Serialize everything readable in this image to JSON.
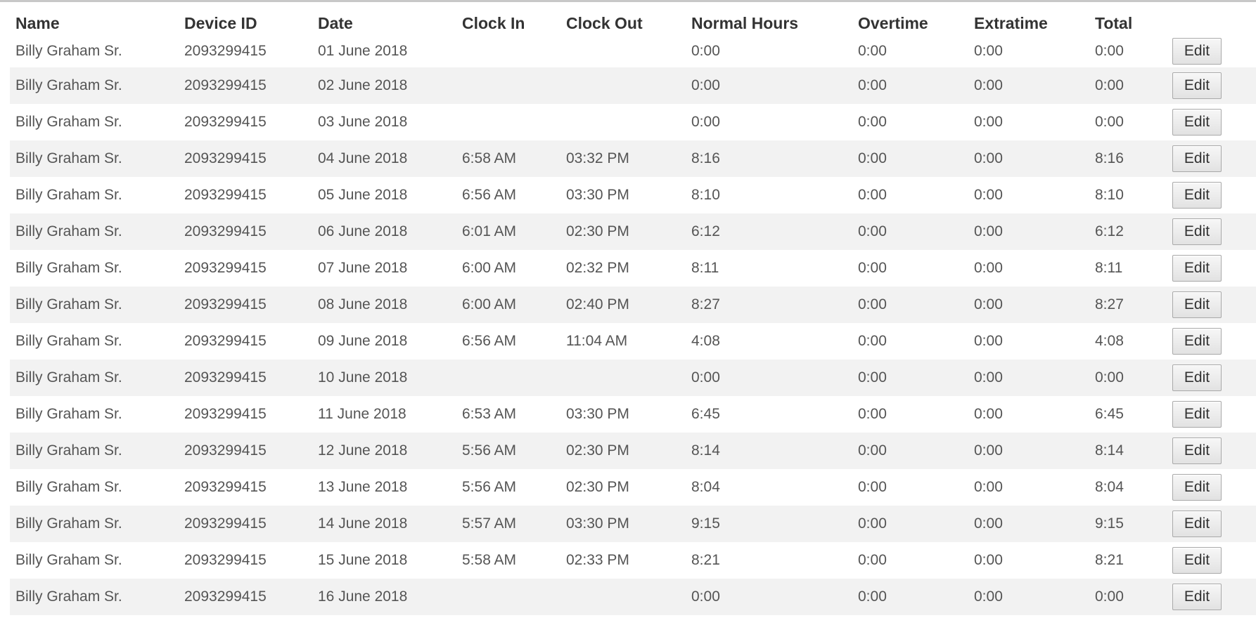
{
  "table": {
    "headers": [
      "Name",
      "Device ID",
      "Date",
      "Clock In",
      "Clock Out",
      "Normal Hours",
      "Overtime",
      "Extratime",
      "Total",
      ""
    ],
    "edit_label": "Edit",
    "rows": [
      {
        "name": "Billy Graham Sr.",
        "device_id": "2093299415",
        "date": "01 June 2018",
        "clock_in": "",
        "clock_out": "",
        "normal_hours": "0:00",
        "overtime": "0:00",
        "extratime": "0:00",
        "total": "0:00"
      },
      {
        "name": "Billy Graham Sr.",
        "device_id": "2093299415",
        "date": "02 June 2018",
        "clock_in": "",
        "clock_out": "",
        "normal_hours": "0:00",
        "overtime": "0:00",
        "extratime": "0:00",
        "total": "0:00"
      },
      {
        "name": "Billy Graham Sr.",
        "device_id": "2093299415",
        "date": "03 June 2018",
        "clock_in": "",
        "clock_out": "",
        "normal_hours": "0:00",
        "overtime": "0:00",
        "extratime": "0:00",
        "total": "0:00"
      },
      {
        "name": "Billy Graham Sr.",
        "device_id": "2093299415",
        "date": "04 June 2018",
        "clock_in": "6:58 AM",
        "clock_out": "03:32 PM",
        "normal_hours": "8:16",
        "overtime": "0:00",
        "extratime": "0:00",
        "total": "8:16"
      },
      {
        "name": "Billy Graham Sr.",
        "device_id": "2093299415",
        "date": "05 June 2018",
        "clock_in": "6:56 AM",
        "clock_out": "03:30 PM",
        "normal_hours": "8:10",
        "overtime": "0:00",
        "extratime": "0:00",
        "total": "8:10"
      },
      {
        "name": "Billy Graham Sr.",
        "device_id": "2093299415",
        "date": "06 June 2018",
        "clock_in": "6:01 AM",
        "clock_out": "02:30 PM",
        "normal_hours": "6:12",
        "overtime": "0:00",
        "extratime": "0:00",
        "total": "6:12"
      },
      {
        "name": "Billy Graham Sr.",
        "device_id": "2093299415",
        "date": "07 June 2018",
        "clock_in": "6:00 AM",
        "clock_out": "02:32 PM",
        "normal_hours": "8:11",
        "overtime": "0:00",
        "extratime": "0:00",
        "total": "8:11"
      },
      {
        "name": "Billy Graham Sr.",
        "device_id": "2093299415",
        "date": "08 June 2018",
        "clock_in": "6:00 AM",
        "clock_out": "02:40 PM",
        "normal_hours": "8:27",
        "overtime": "0:00",
        "extratime": "0:00",
        "total": "8:27"
      },
      {
        "name": "Billy Graham Sr.",
        "device_id": "2093299415",
        "date": "09 June 2018",
        "clock_in": "6:56 AM",
        "clock_out": "11:04 AM",
        "normal_hours": "4:08",
        "overtime": "0:00",
        "extratime": "0:00",
        "total": "4:08"
      },
      {
        "name": "Billy Graham Sr.",
        "device_id": "2093299415",
        "date": "10 June 2018",
        "clock_in": "",
        "clock_out": "",
        "normal_hours": "0:00",
        "overtime": "0:00",
        "extratime": "0:00",
        "total": "0:00"
      },
      {
        "name": "Billy Graham Sr.",
        "device_id": "2093299415",
        "date": "11 June 2018",
        "clock_in": "6:53 AM",
        "clock_out": "03:30 PM",
        "normal_hours": "6:45",
        "overtime": "0:00",
        "extratime": "0:00",
        "total": "6:45"
      },
      {
        "name": "Billy Graham Sr.",
        "device_id": "2093299415",
        "date": "12 June 2018",
        "clock_in": "5:56 AM",
        "clock_out": "02:30 PM",
        "normal_hours": "8:14",
        "overtime": "0:00",
        "extratime": "0:00",
        "total": "8:14"
      },
      {
        "name": "Billy Graham Sr.",
        "device_id": "2093299415",
        "date": "13 June 2018",
        "clock_in": "5:56 AM",
        "clock_out": "02:30 PM",
        "normal_hours": "8:04",
        "overtime": "0:00",
        "extratime": "0:00",
        "total": "8:04"
      },
      {
        "name": "Billy Graham Sr.",
        "device_id": "2093299415",
        "date": "14 June 2018",
        "clock_in": "5:57 AM",
        "clock_out": "03:30 PM",
        "normal_hours": "9:15",
        "overtime": "0:00",
        "extratime": "0:00",
        "total": "9:15"
      },
      {
        "name": "Billy Graham Sr.",
        "device_id": "2093299415",
        "date": "15 June 2018",
        "clock_in": "5:58 AM",
        "clock_out": "02:33 PM",
        "normal_hours": "8:21",
        "overtime": "0:00",
        "extratime": "0:00",
        "total": "8:21"
      },
      {
        "name": "Billy Graham Sr.",
        "device_id": "2093299415",
        "date": "16 June 2018",
        "clock_in": "",
        "clock_out": "",
        "normal_hours": "0:00",
        "overtime": "0:00",
        "extratime": "0:00",
        "total": "0:00"
      }
    ]
  }
}
